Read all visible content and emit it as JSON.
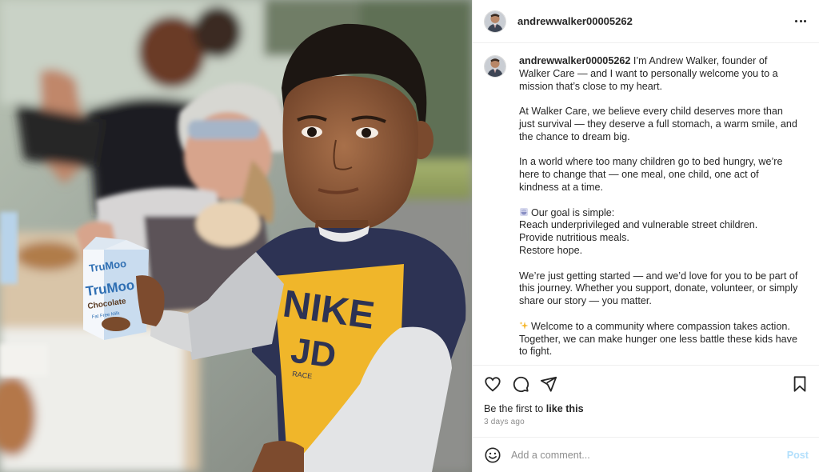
{
  "post": {
    "username": "andrewwalker00005262",
    "more_icon": "more-horizontal-icon"
  },
  "photo": {
    "carton_brand": "TruMoo",
    "carton_flavor": "Chocolate",
    "carton_subtext": "Fat Free Milk",
    "shirt_text_1": "NIKE",
    "shirt_text_2": "JD",
    "shirt_small_text": "RACE"
  },
  "caption": {
    "username": "andrewwalker00005262",
    "intro": " I’m Andrew Walker, founder of Walker Care — and I want to personally welcome you to a mission that’s close to my heart.",
    "para2": "At Walker Care, we believe every child deserves more than just survival — they deserve a full stomach, a warm smile, and the chance to dream big.",
    "para3": "In a world where too many children go to bed hungry, we’re here to change that — one meal, one child, one act of kindness at a time.",
    "goal_heading": "Our goal is simple:",
    "goal_line1": "Reach underprivileged and vulnerable street children.",
    "goal_line2": "Provide nutritious meals.",
    "goal_line3": "Restore hope.",
    "para5": "We’re just getting started — and we’d love for you to be part of this journey. Whether you support, donate, volunteer, or simply share our story — you matter.",
    "para6": "Welcome to a community where compassion takes action. Together, we can make hunger one less battle these kids have to fight.",
    "goal_emoji": "bowl-emoji",
    "welcome_emoji": "sparkles-emoji"
  },
  "actions": {
    "like_icon": "heart-icon",
    "comment_icon": "comment-icon",
    "share_icon": "send-icon",
    "save_icon": "bookmark-icon"
  },
  "likes": {
    "prefix": "Be the first to ",
    "link": "like this"
  },
  "timestamp": "3 days ago",
  "comment": {
    "placeholder": "Add a comment...",
    "post_label": "Post",
    "emoji_icon": "smiley-icon"
  },
  "colors": {
    "post_button": "#b2dffc",
    "text": "#262626",
    "muted": "#8e8e8e",
    "divider": "#efefef"
  }
}
